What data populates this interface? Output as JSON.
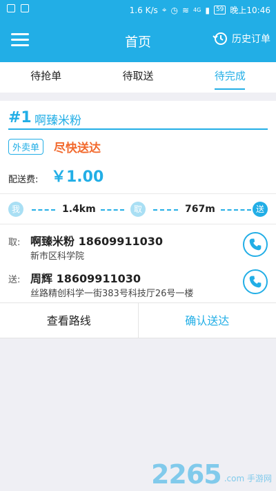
{
  "status_bar": {
    "speed": "1.6 K/s",
    "network": "4G",
    "battery": "59",
    "time": "晚上10:46"
  },
  "header": {
    "menu_icon": "menu-icon",
    "title": "首页",
    "history_icon": "history-clock-icon",
    "history_label": "历史订单"
  },
  "tabs": [
    {
      "label": "待抢单",
      "active": false
    },
    {
      "label": "待取送",
      "active": false
    },
    {
      "label": "待完成",
      "active": true
    }
  ],
  "order": {
    "number": "#1",
    "shop_name": "啊臻米粉",
    "type_badge": "外卖单",
    "urgency": "尽快送达",
    "fee_label": "配送费:",
    "fee_value": "￥1.00",
    "route": {
      "me_label": "我",
      "pickup_label": "取",
      "deliver_label": "送",
      "dist_to_pickup": "1.4km",
      "dist_to_deliver": "767m"
    },
    "pickup": {
      "label": "取:",
      "name_phone": "啊臻米粉 18609911030",
      "address": "新市区科学院"
    },
    "delivery": {
      "label": "送:",
      "name_phone": "周辉 18609911030",
      "address": "丝路精创科学一街383号科技厅26号一楼"
    },
    "actions": {
      "view_route": "查看路线",
      "confirm": "确认送达"
    }
  },
  "watermark": {
    "number": "2265",
    "text": ".com 手游网"
  },
  "colors": {
    "primary": "#22aee6",
    "urgent": "#f26a2e",
    "background": "#efeff4"
  }
}
